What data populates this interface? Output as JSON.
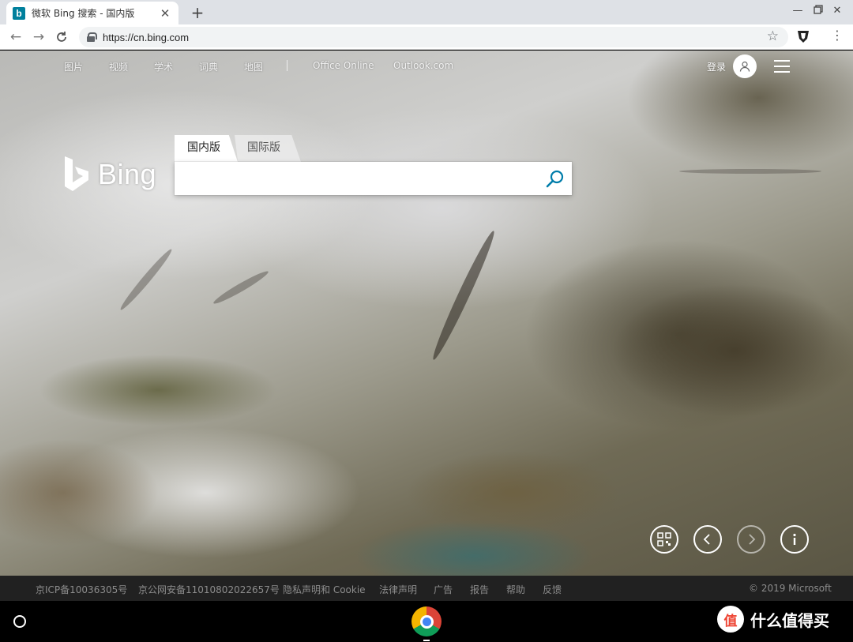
{
  "browser": {
    "tab_title": "微软 Bing 搜索 - 国内版",
    "favicon_letter": "b",
    "url": "https://cn.bing.com",
    "icons": {
      "close": "close-icon",
      "new_tab": "plus-icon",
      "minimize": "minimize-icon",
      "restore": "restore-icon",
      "window_close": "close-icon",
      "back": "arrow-left-icon",
      "forward": "arrow-right-icon",
      "reload": "reload-icon",
      "lock": "lock-icon",
      "bookmark": "star-icon",
      "extension": "shield-extension-icon",
      "menu": "vertical-dots-icon"
    }
  },
  "bing": {
    "nav": [
      "图片",
      "视频",
      "学术",
      "词典",
      "地图",
      "Office Online",
      "Outlook.com"
    ],
    "signin": "登录",
    "logo_text": "Bing",
    "search_tabs": [
      "国内版",
      "国际版"
    ],
    "search_placeholder": "",
    "hero_buttons": [
      "qr-code-icon",
      "chevron-left-icon",
      "chevron-right-icon",
      "info-icon"
    ],
    "accent_color": "#00809d"
  },
  "footer": {
    "links": [
      "京ICP备10036305号",
      "京公网安备11010802022657号",
      "隐私声明和 Cookie",
      "法律声明",
      "广告",
      "报告",
      "帮助",
      "反馈"
    ],
    "copyright": "© 2019 Microsoft"
  },
  "shelf": {
    "watermark_badge": "值",
    "watermark_text": "什么值得买"
  }
}
